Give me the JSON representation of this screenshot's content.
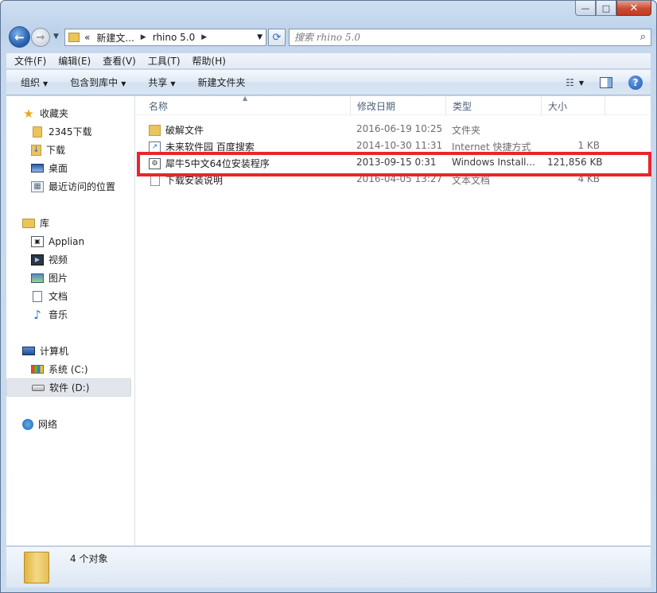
{
  "window": {
    "caption": {
      "minimize": "—",
      "maximize": "□",
      "close": "✕"
    }
  },
  "nav": {
    "back": "←",
    "forward": "→",
    "breadcrumb": [
      "«",
      "新建文...",
      "rhino 5.0"
    ],
    "search_placeholder": "搜索 rhino 5.0"
  },
  "menu": [
    "文件(F)",
    "编辑(E)",
    "查看(V)",
    "工具(T)",
    "帮助(H)"
  ],
  "toolbar": {
    "organize": "组织",
    "include_library": "包含到库中",
    "share": "共享",
    "new_folder": "新建文件夹",
    "help": "?"
  },
  "sidebar": {
    "favorites": {
      "label": "收藏夹",
      "items": [
        "2345下载",
        "下载",
        "桌面",
        "最近访问的位置"
      ]
    },
    "libraries": {
      "label": "库",
      "items": [
        "Applian",
        "视频",
        "图片",
        "文档",
        "音乐"
      ]
    },
    "computer": {
      "label": "计算机",
      "items": [
        "系统 (C:)",
        "软件 (D:)"
      ],
      "selected": "软件 (D:)"
    },
    "network": {
      "label": "网络"
    }
  },
  "columns": {
    "name": "名称",
    "date": "修改日期",
    "type": "类型",
    "size": "大小"
  },
  "files": [
    {
      "name": "破解文件",
      "date": "2016-06-19 10:25",
      "type": "文件夹",
      "size": "",
      "icon": "folder-icon"
    },
    {
      "name": "未来软件园 百度搜索",
      "date": "2014-10-30 11:31",
      "type": "Internet 快捷方式",
      "size": "1 KB",
      "icon": "internet-shortcut-icon"
    },
    {
      "name": "犀牛5中文64位安装程序",
      "date": "2013-09-15 0:31",
      "type": "Windows Install...",
      "size": "121,856 KB",
      "icon": "installer-icon"
    },
    {
      "name": "下载安装说明",
      "date": "2016-04-05 13:27",
      "type": "文本文档",
      "size": "4 KB",
      "icon": "text-file-icon"
    }
  ],
  "highlight_color": "#e8262c",
  "status": {
    "count": "4 个对象"
  }
}
